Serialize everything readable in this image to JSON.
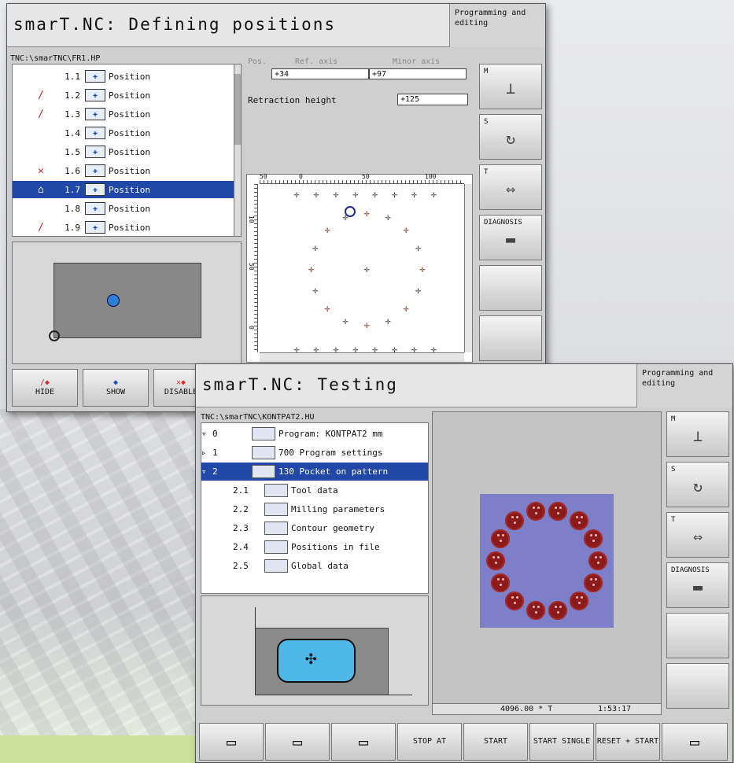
{
  "win1": {
    "title": "smarT.NC: Defining positions",
    "mode": "Programming and editing",
    "path": "TNC:\\smarTNC\\FR1.HP",
    "rows": [
      {
        "num": "1.1",
        "label": "Position",
        "mark": ""
      },
      {
        "num": "1.2",
        "label": "Position",
        "mark": "/"
      },
      {
        "num": "1.3",
        "label": "Position",
        "mark": "/"
      },
      {
        "num": "1.4",
        "label": "Position",
        "mark": ""
      },
      {
        "num": "1.5",
        "label": "Position",
        "mark": ""
      },
      {
        "num": "1.6",
        "label": "Position",
        "mark": "✕"
      },
      {
        "num": "1.7",
        "label": "Position",
        "mark": "⌂"
      },
      {
        "num": "1.8",
        "label": "Position",
        "mark": ""
      },
      {
        "num": "1.9",
        "label": "Position",
        "mark": "/"
      }
    ],
    "pos_header": {
      "pos": "Pos.",
      "ref": "Ref. axis",
      "minor": "Minor axis"
    },
    "pos_values": {
      "ref": "+34",
      "minor": "+97"
    },
    "retraction_label": "Retraction height",
    "retraction_value": "+125",
    "ruler_top": [
      "50",
      "0",
      "50",
      "100"
    ],
    "ruler_left": [
      "10",
      "50",
      "0"
    ],
    "softkeys": [
      "HIDE",
      "SHOW",
      "DISABLE"
    ],
    "side": [
      {
        "label": "M",
        "icon": "spindle-icon"
      },
      {
        "label": "S",
        "icon": "spindle-rotate-icon"
      },
      {
        "label": "T",
        "icon": "tool-change-icon"
      },
      {
        "label": "DIAGNOSIS",
        "icon": "diagnosis-icon"
      },
      {
        "label": "",
        "icon": ""
      },
      {
        "label": "",
        "icon": ""
      }
    ]
  },
  "win2": {
    "title": "smarT.NC: Testing",
    "mode": "Programming and editing",
    "path": "TNC:\\smarTNC\\KONTPAT2.HU",
    "tree": [
      {
        "num": "0",
        "label": "Program: KONTPAT2 mm",
        "arrow": "▿"
      },
      {
        "num": "1",
        "label": "700 Program settings",
        "arrow": "▹"
      },
      {
        "num": "2",
        "label": "130 Pocket on pattern",
        "arrow": "▿"
      },
      {
        "num": "2.1",
        "label": "Tool data",
        "arrow": ""
      },
      {
        "num": "2.2",
        "label": "Milling parameters",
        "arrow": ""
      },
      {
        "num": "2.3",
        "label": "Contour geometry",
        "arrow": ""
      },
      {
        "num": "2.4",
        "label": "Positions in file",
        "arrow": ""
      },
      {
        "num": "2.5",
        "label": "Global data",
        "arrow": ""
      }
    ],
    "status": {
      "value": "4096.00 * T",
      "time": "1:53:17"
    },
    "softkeys": [
      "",
      "",
      "",
      "STOP AT",
      "START",
      "START SINGLE",
      "RESET + START",
      ""
    ],
    "side": [
      {
        "label": "M",
        "icon": "spindle-icon"
      },
      {
        "label": "S",
        "icon": "spindle-rotate-icon"
      },
      {
        "label": "T",
        "icon": "tool-change-icon"
      },
      {
        "label": "DIAGNOSIS",
        "icon": "diagnosis-icon"
      },
      {
        "label": "",
        "icon": ""
      },
      {
        "label": "",
        "icon": ""
      }
    ]
  },
  "colors": {
    "selection": "#2148a8",
    "pocket": "#8b1a1a",
    "sim_bg": "#7d7fc9"
  }
}
